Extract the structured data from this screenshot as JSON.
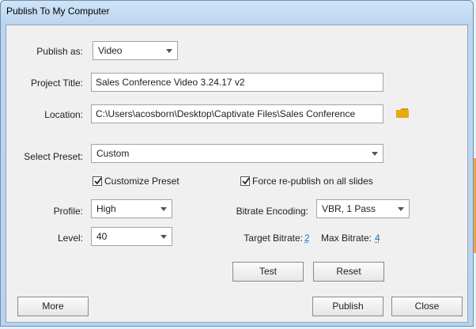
{
  "window": {
    "title": "Publish To My Computer"
  },
  "colors": {
    "accent_link": "#1f6fbf",
    "folder": "#e8a915"
  },
  "publish_as": {
    "label": "Publish as:",
    "value": "Video"
  },
  "project_title": {
    "label": "Project Title:",
    "value": "Sales Conference Video 3.24.17 v2"
  },
  "location": {
    "label": "Location:",
    "value": "C:\\Users\\acosborn\\Desktop\\Captivate Files\\Sales Conference",
    "icon": "folder-icon"
  },
  "preset": {
    "label": "Select Preset:",
    "value": "Custom"
  },
  "customize_preset": {
    "label": "Customize Preset",
    "checked": true
  },
  "force_republish": {
    "label": "Force re-publish on all slides",
    "checked": true
  },
  "profile": {
    "label": "Profile:",
    "value": "High"
  },
  "level": {
    "label": "Level:",
    "value": "40"
  },
  "bitrate_encoding": {
    "label": "Bitrate Encoding:",
    "value": "VBR, 1 Pass"
  },
  "target_bitrate": {
    "label": "Target Bitrate:",
    "value": "2"
  },
  "max_bitrate": {
    "label": "Max Bitrate:",
    "value": "4"
  },
  "buttons": {
    "test": "Test",
    "reset": "Reset",
    "more": "More",
    "publish": "Publish",
    "close": "Close"
  }
}
